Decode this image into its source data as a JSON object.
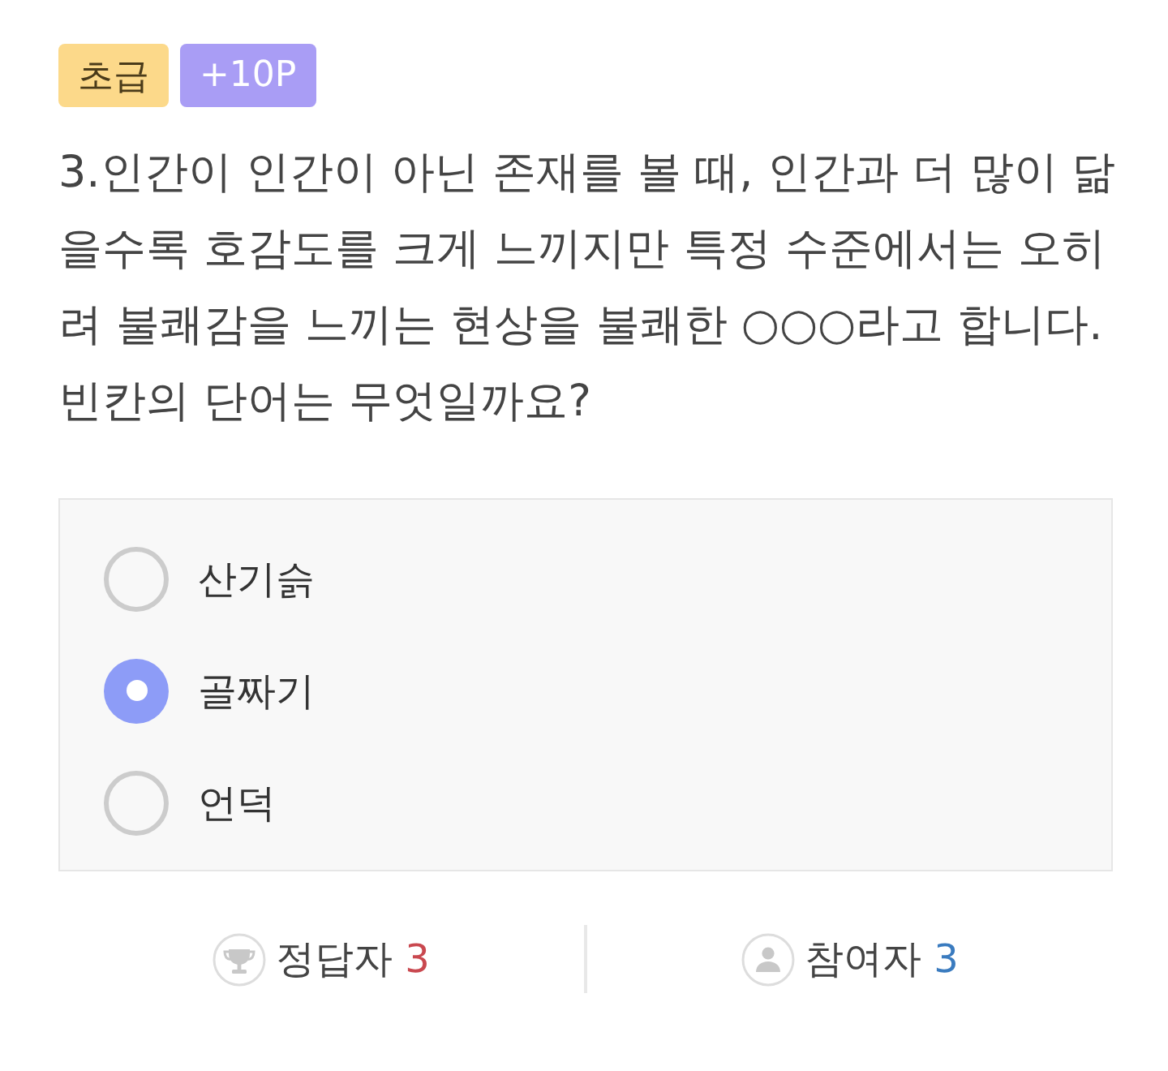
{
  "badges": [
    {
      "kind": "level",
      "label": "초급"
    },
    {
      "kind": "points",
      "label": "+10P"
    }
  ],
  "question": {
    "text": "3.인간이 인간이 아닌 존재를 볼 때, 인간과 더 많이 닮을수록 호감도를 크게 느끼지만 특정 수준에서는 오히려 불쾌감을 느끼는 현상을 불쾌한 ○○○라고 합니다. 빈칸의 단어는 무엇일까요?"
  },
  "options": [
    {
      "label": "산기슭",
      "selected": false
    },
    {
      "label": "골짜기",
      "selected": true
    },
    {
      "label": "언덕",
      "selected": false
    }
  ],
  "stats": [
    {
      "kind": "correct",
      "label": "정답자",
      "count": "3"
    },
    {
      "kind": "participants",
      "label": "참여자",
      "count": "3"
    }
  ]
}
